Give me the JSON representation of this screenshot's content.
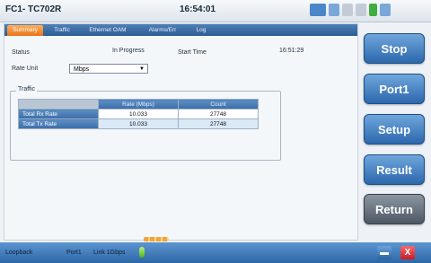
{
  "window": {
    "title": "FC1- TC702R",
    "clock": "16:54:01"
  },
  "status_icons": [
    "network-icon",
    "display-icon",
    "signal-icon",
    "usb-icon",
    "battery-icon"
  ],
  "tabs": [
    {
      "label": "Summary",
      "active": true
    },
    {
      "label": "Traffic",
      "active": false
    },
    {
      "label": "Ethernet OAM",
      "active": false
    },
    {
      "label": "Alarms/Err",
      "active": false
    },
    {
      "label": "Log",
      "active": false
    }
  ],
  "status": {
    "label": "Status",
    "value": "In Progress",
    "start_label": "Start Time",
    "start_value": "16:51:29"
  },
  "rate_unit": {
    "label": "Rate Unit",
    "value": "Mbps"
  },
  "traffic": {
    "title": "Traffic",
    "headers": [
      "",
      "Rate (Mbps)",
      "Count"
    ],
    "rows": [
      {
        "label": "Total Rx Rate",
        "rate": "10.033",
        "count": "27748"
      },
      {
        "label": "Total Tx Rate",
        "rate": "10.033",
        "count": "27748"
      }
    ]
  },
  "buttons": {
    "stop": "Stop",
    "port": "Port1",
    "setup": "Setup",
    "result": "Result",
    "return": "Return"
  },
  "statusbar": {
    "mode": "Loopback",
    "port": "Port1",
    "link": "Link 1Gbps",
    "close": "X"
  },
  "colors": {
    "accent": "#2c68ad",
    "active_tab": "#e8731a",
    "close": "#d7262b"
  }
}
